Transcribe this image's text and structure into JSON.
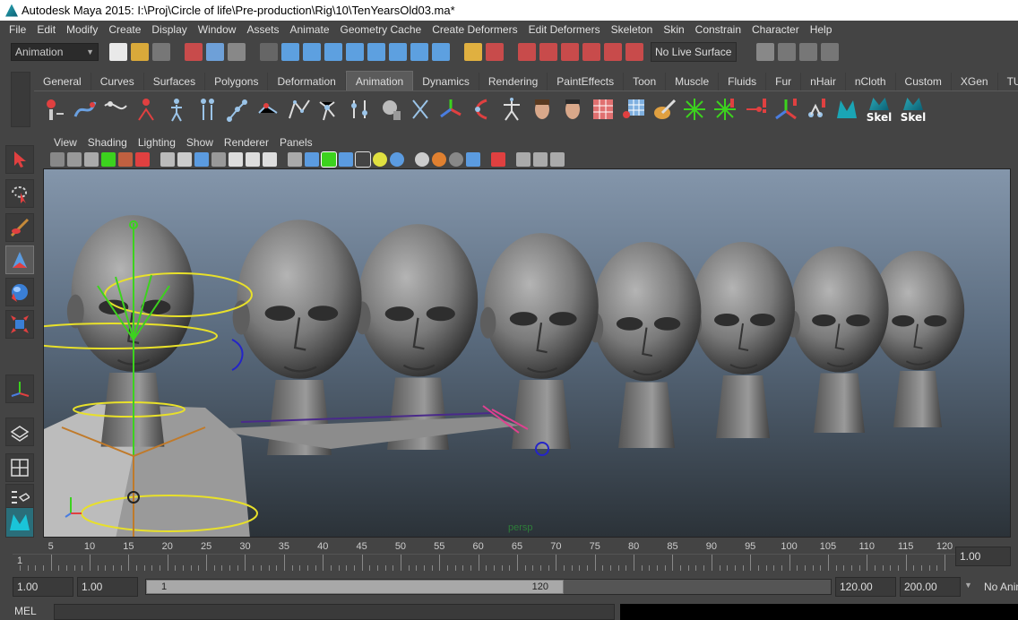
{
  "window": {
    "title": "Autodesk Maya 2015: I:\\Proj\\Circle of life\\Pre-production\\Rig\\10\\TenYearsOld03.ma*"
  },
  "menu": [
    "File",
    "Edit",
    "Modify",
    "Create",
    "Display",
    "Window",
    "Assets",
    "Animate",
    "Geometry Cache",
    "Create Deformers",
    "Edit Deformers",
    "Skeleton",
    "Skin",
    "Constrain",
    "Character",
    "Help"
  ],
  "status_line": {
    "mode": "Animation",
    "live_surface": "No Live Surface"
  },
  "shelf_tabs": [
    "General",
    "Curves",
    "Surfaces",
    "Polygons",
    "Deformation",
    "Animation",
    "Dynamics",
    "Rendering",
    "PaintEffects",
    "Toon",
    "Muscle",
    "Fluids",
    "Fur",
    "nHair",
    "nCloth",
    "Custom",
    "XGen",
    "TURTLE"
  ],
  "shelf_active": "Animation",
  "shelf_buttons": {
    "skel1": "Skel",
    "skel2": "Skel"
  },
  "panel_menu": [
    "View",
    "Shading",
    "Lighting",
    "Show",
    "Renderer",
    "Panels"
  ],
  "viewport": {
    "camera": "persp"
  },
  "time_slider": {
    "labels": [
      "5",
      "10",
      "15",
      "20",
      "25",
      "30",
      "35",
      "40",
      "45",
      "50",
      "55",
      "60",
      "65",
      "70",
      "75",
      "80",
      "85",
      "90",
      "95",
      "100",
      "105",
      "110",
      "115",
      "120"
    ],
    "start_label": "1",
    "current_frame": "1.00"
  },
  "range_slider": {
    "start": "1.00",
    "start_inner": "1.00",
    "range_start_label": "1",
    "range_end_label": "120",
    "end_inner": "120.00",
    "end": "200.00",
    "anim_layer": "No Anim"
  },
  "command_line": {
    "label": "MEL"
  },
  "colors": {
    "bg": "#444444",
    "viewport_top": "#8496ab",
    "viewport_bottom": "#2b3238",
    "rig_yellow": "#e8e02a",
    "rig_green": "#3cd21e"
  }
}
